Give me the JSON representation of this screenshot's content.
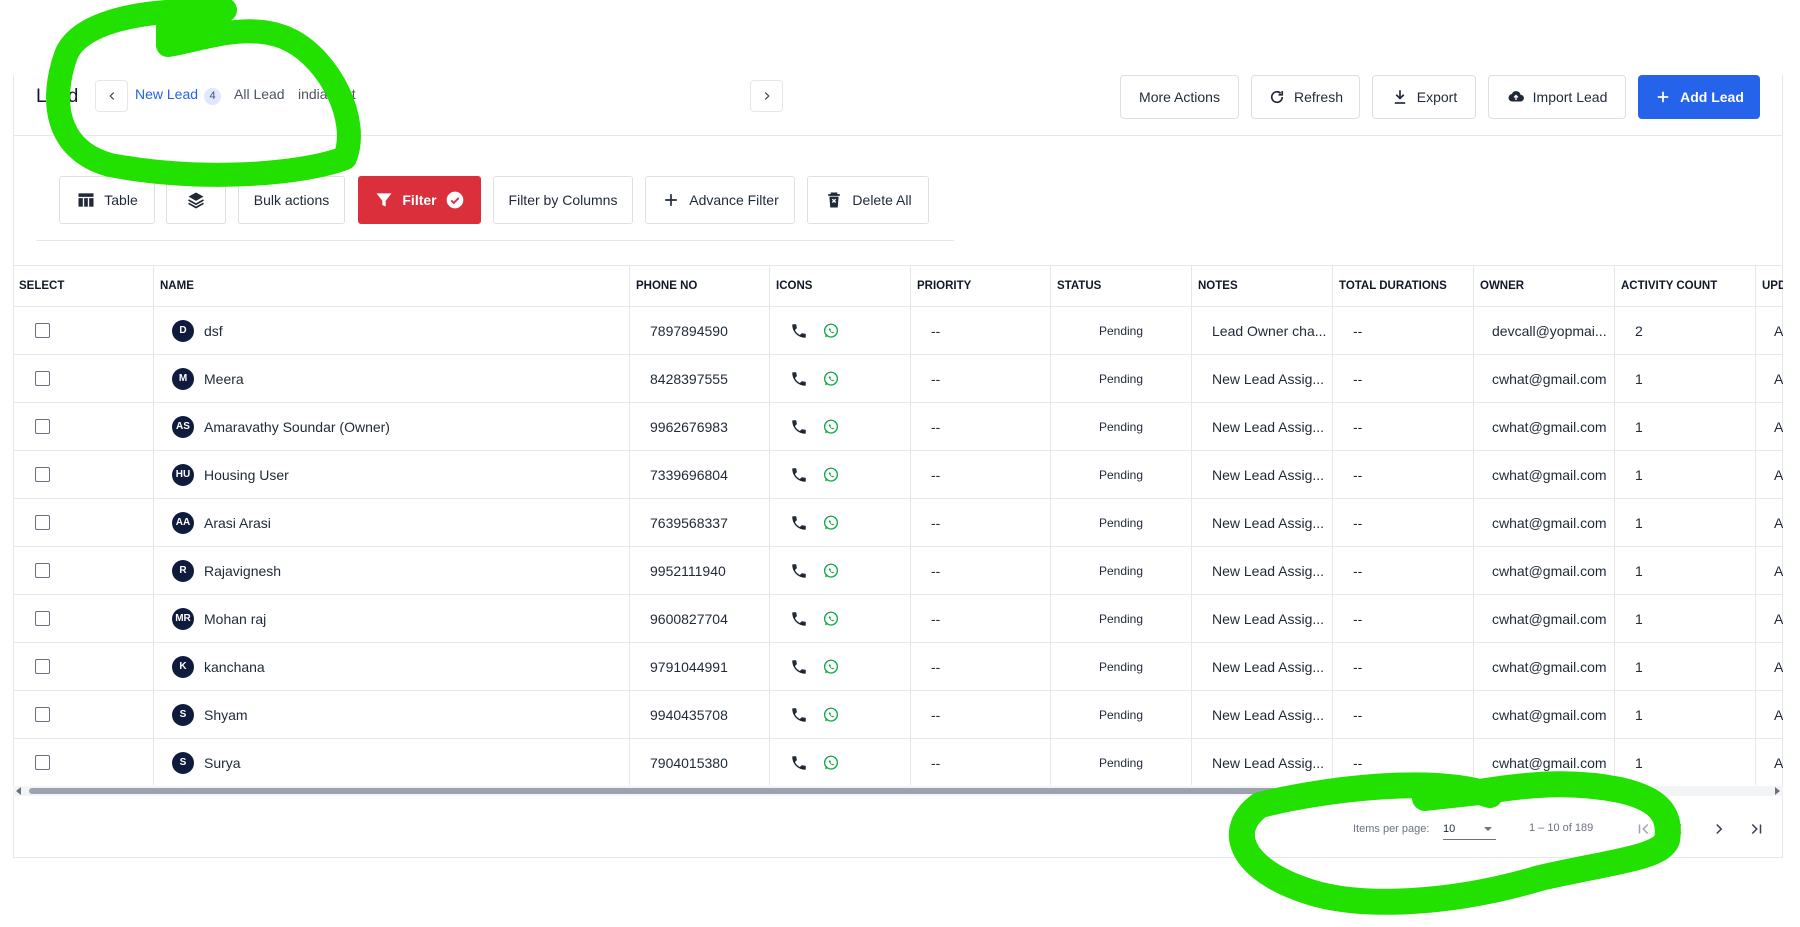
{
  "header": {
    "title": "Lead",
    "tabs": [
      {
        "label": "New Lead",
        "badge": "4",
        "active": true
      },
      {
        "label": "All Lead",
        "active": false
      },
      {
        "label": "indiamart",
        "active": false
      }
    ],
    "buttons": {
      "more_actions": "More Actions",
      "refresh": "Refresh",
      "export": "Export",
      "import": "Import Lead",
      "add": "Add Lead"
    }
  },
  "toolbar": {
    "table": "Table",
    "bulk": "Bulk actions",
    "filter": "Filter",
    "filter_columns": "Filter by Columns",
    "advance_filter": "Advance Filter",
    "delete_all": "Delete All"
  },
  "table": {
    "columns": [
      "SELECT",
      "NAME",
      "PHONE NO",
      "ICONS",
      "PRIORITY",
      "STATUS",
      "NOTES",
      "TOTAL DURATIONS",
      "OWNER",
      "ACTIVITY COUNT",
      "UPD"
    ],
    "rows": [
      {
        "initials": "D",
        "name": "dsf",
        "phone": "7897894590",
        "priority": "--",
        "status": "Pending",
        "notes": "Lead Owner cha...",
        "duration": "--",
        "owner": "devcall@yopmai...",
        "activity": "2",
        "upd": "A"
      },
      {
        "initials": "M",
        "name": "Meera",
        "phone": "8428397555",
        "priority": "--",
        "status": "Pending",
        "notes": "New Lead Assig...",
        "duration": "--",
        "owner": "cwhat@gmail.com",
        "activity": "1",
        "upd": "A"
      },
      {
        "initials": "AS",
        "name": "Amaravathy Soundar (Owner)",
        "phone": "9962676983",
        "priority": "--",
        "status": "Pending",
        "notes": "New Lead Assig...",
        "duration": "--",
        "owner": "cwhat@gmail.com",
        "activity": "1",
        "upd": "A"
      },
      {
        "initials": "HU",
        "name": "Housing User",
        "phone": "7339696804",
        "priority": "--",
        "status": "Pending",
        "notes": "New Lead Assig...",
        "duration": "--",
        "owner": "cwhat@gmail.com",
        "activity": "1",
        "upd": "A"
      },
      {
        "initials": "AA",
        "name": "Arasi Arasi",
        "phone": "7639568337",
        "priority": "--",
        "status": "Pending",
        "notes": "New Lead Assig...",
        "duration": "--",
        "owner": "cwhat@gmail.com",
        "activity": "1",
        "upd": "A"
      },
      {
        "initials": "R",
        "name": "Rajavignesh",
        "phone": "9952111940",
        "priority": "--",
        "status": "Pending",
        "notes": "New Lead Assig...",
        "duration": "--",
        "owner": "cwhat@gmail.com",
        "activity": "1",
        "upd": "A"
      },
      {
        "initials": "MR",
        "name": "Mohan raj",
        "phone": "9600827704",
        "priority": "--",
        "status": "Pending",
        "notes": "New Lead Assig...",
        "duration": "--",
        "owner": "cwhat@gmail.com",
        "activity": "1",
        "upd": "A"
      },
      {
        "initials": "K",
        "name": "kanchana",
        "phone": "9791044991",
        "priority": "--",
        "status": "Pending",
        "notes": "New Lead Assig...",
        "duration": "--",
        "owner": "cwhat@gmail.com",
        "activity": "1",
        "upd": "A"
      },
      {
        "initials": "S",
        "name": "Shyam",
        "phone": "9940435708",
        "priority": "--",
        "status": "Pending",
        "notes": "New Lead Assig...",
        "duration": "--",
        "owner": "cwhat@gmail.com",
        "activity": "1",
        "upd": "A"
      },
      {
        "initials": "S",
        "name": "Surya",
        "phone": "7904015380",
        "priority": "--",
        "status": "Pending",
        "notes": "New Lead Assig...",
        "duration": "--",
        "owner": "cwhat@gmail.com",
        "activity": "1",
        "upd": "A"
      }
    ]
  },
  "paginator": {
    "items_per_page_label": "Items per page:",
    "items_per_page": "10",
    "range": "1 – 10 of 189"
  },
  "colors": {
    "primary": "#2563eb",
    "filter": "#dc2f3c",
    "avatar": "#0f1b3d",
    "whatsapp": "#16a34a",
    "annotation": "#22e000"
  },
  "icons": [
    "chevron-left-icon",
    "chevron-right-icon",
    "refresh-icon",
    "download-icon",
    "cloud-upload-icon",
    "plus-icon",
    "table-icon",
    "layers-icon",
    "filter-icon",
    "check-circle-icon",
    "delete-icon",
    "phone-icon",
    "whatsapp-icon",
    "first-page-icon",
    "prev-page-icon",
    "next-page-icon",
    "last-page-icon"
  ]
}
